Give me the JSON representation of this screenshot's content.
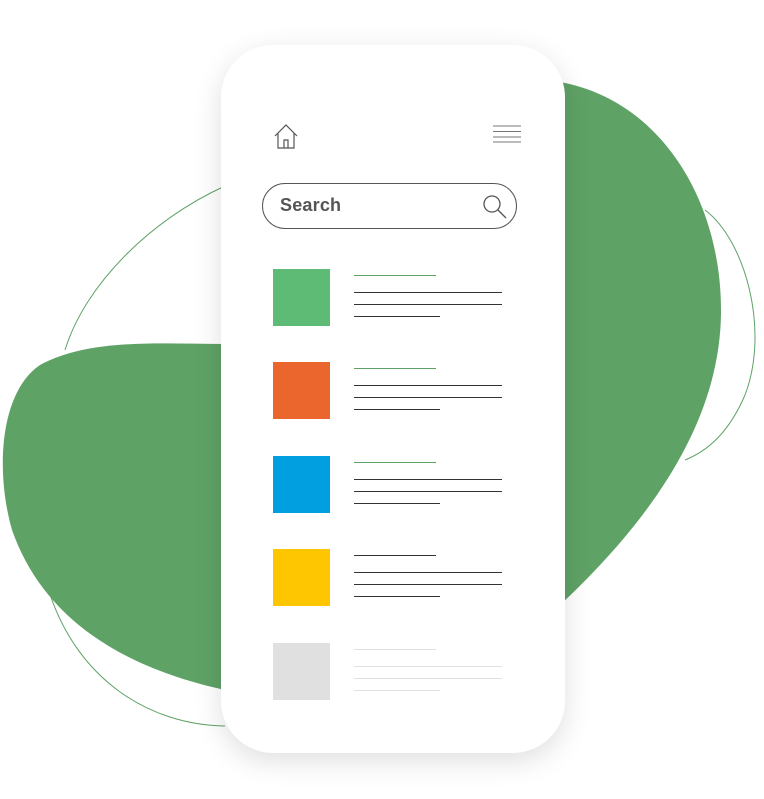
{
  "colors": {
    "blob": "#5fa266",
    "outline": "#5fa266",
    "line": "#333333"
  },
  "header": {
    "home_icon": "home-icon",
    "menu_icon": "hamburger-menu-icon"
  },
  "search": {
    "placeholder": "Search",
    "icon": "magnifier-icon"
  },
  "list": {
    "items": [
      {
        "color": "#5dbb76",
        "accent": "#5fa266"
      },
      {
        "color": "#ea662c",
        "accent": "#5fa266"
      },
      {
        "color": "#019fe0",
        "accent": "#5fa266"
      },
      {
        "color": "#fec600",
        "accent": "#333333"
      },
      {
        "color": "#e0e0e0",
        "accent": "#dddddd"
      }
    ]
  }
}
